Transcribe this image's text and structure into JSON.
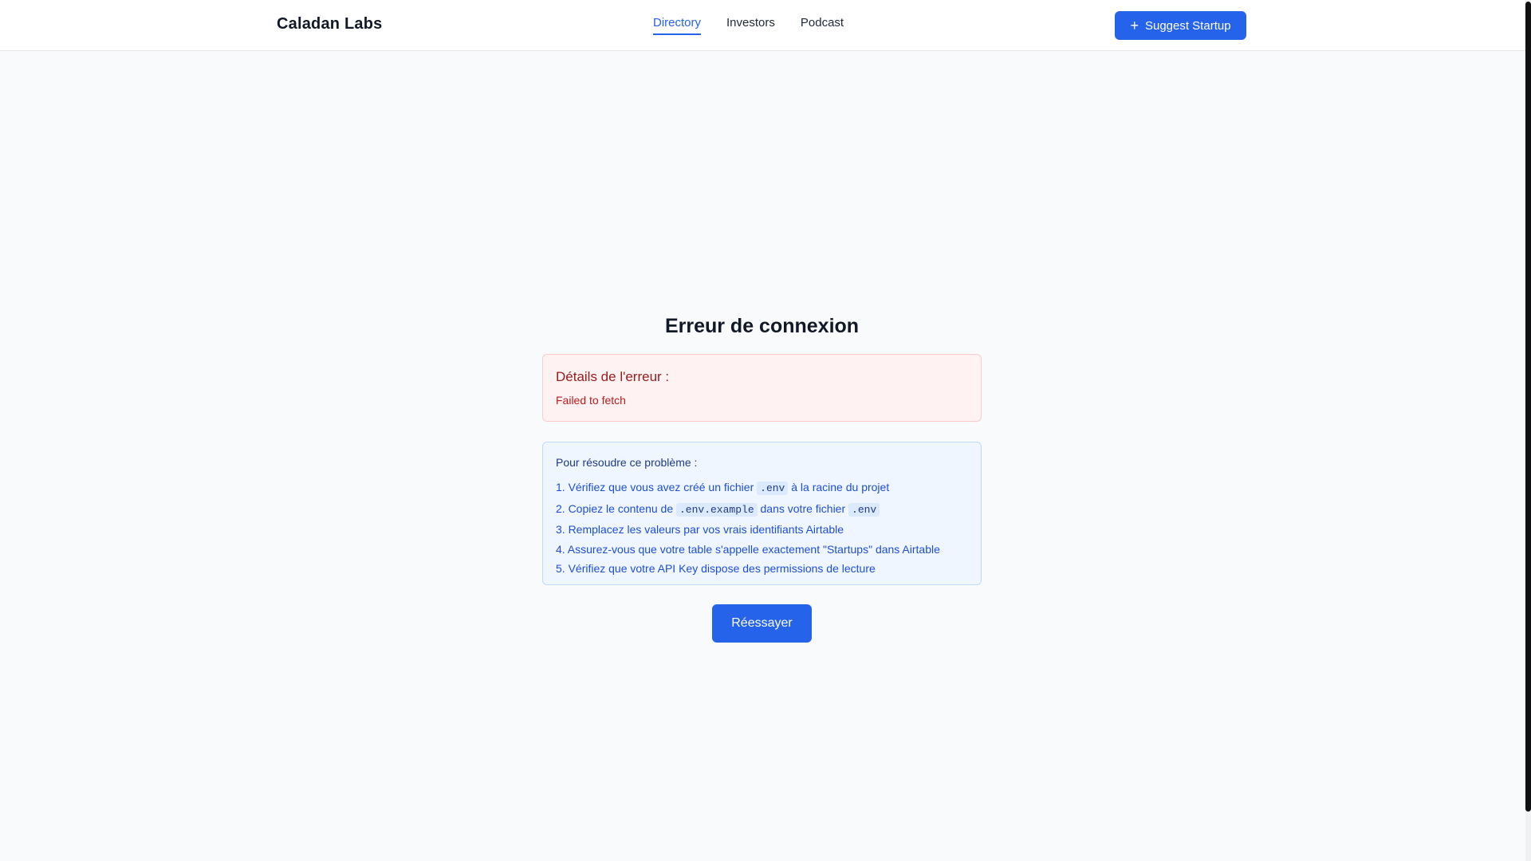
{
  "header": {
    "brand": "Caladan Labs",
    "nav": [
      {
        "label": "Directory",
        "active": true
      },
      {
        "label": "Investors",
        "active": false
      },
      {
        "label": "Podcast",
        "active": false
      }
    ],
    "suggest_button": {
      "icon": "plus-icon",
      "label": "Suggest Startup"
    }
  },
  "main": {
    "title": "Erreur de connexion",
    "error": {
      "heading": "Détails de l'erreur :",
      "message": "Failed to fetch"
    },
    "help": {
      "heading": "Pour résoudre ce problème :",
      "steps": [
        {
          "before": "1. Vérifiez que vous avez créé un fichier ",
          "code": ".env",
          "after": " à la racine du projet"
        },
        {
          "before": "2. Copiez le contenu de ",
          "code": ".env.example",
          "middle": " dans votre fichier ",
          "code2": ".env"
        },
        {
          "text": "3. Remplacez les valeurs par vos vrais identifiants Airtable"
        },
        {
          "text": "4. Assurez-vous que votre table s'appelle exactement \"Startups\" dans Airtable"
        },
        {
          "text": "5. Vérifiez que votre API Key dispose des permissions de lecture"
        }
      ]
    },
    "retry_label": "Réessayer"
  },
  "colors": {
    "accent": "#2563eb",
    "error_bg": "#fef2f2",
    "error_text": "#991b1b",
    "help_bg": "#eff6ff",
    "help_text": "#1d4ed8"
  }
}
